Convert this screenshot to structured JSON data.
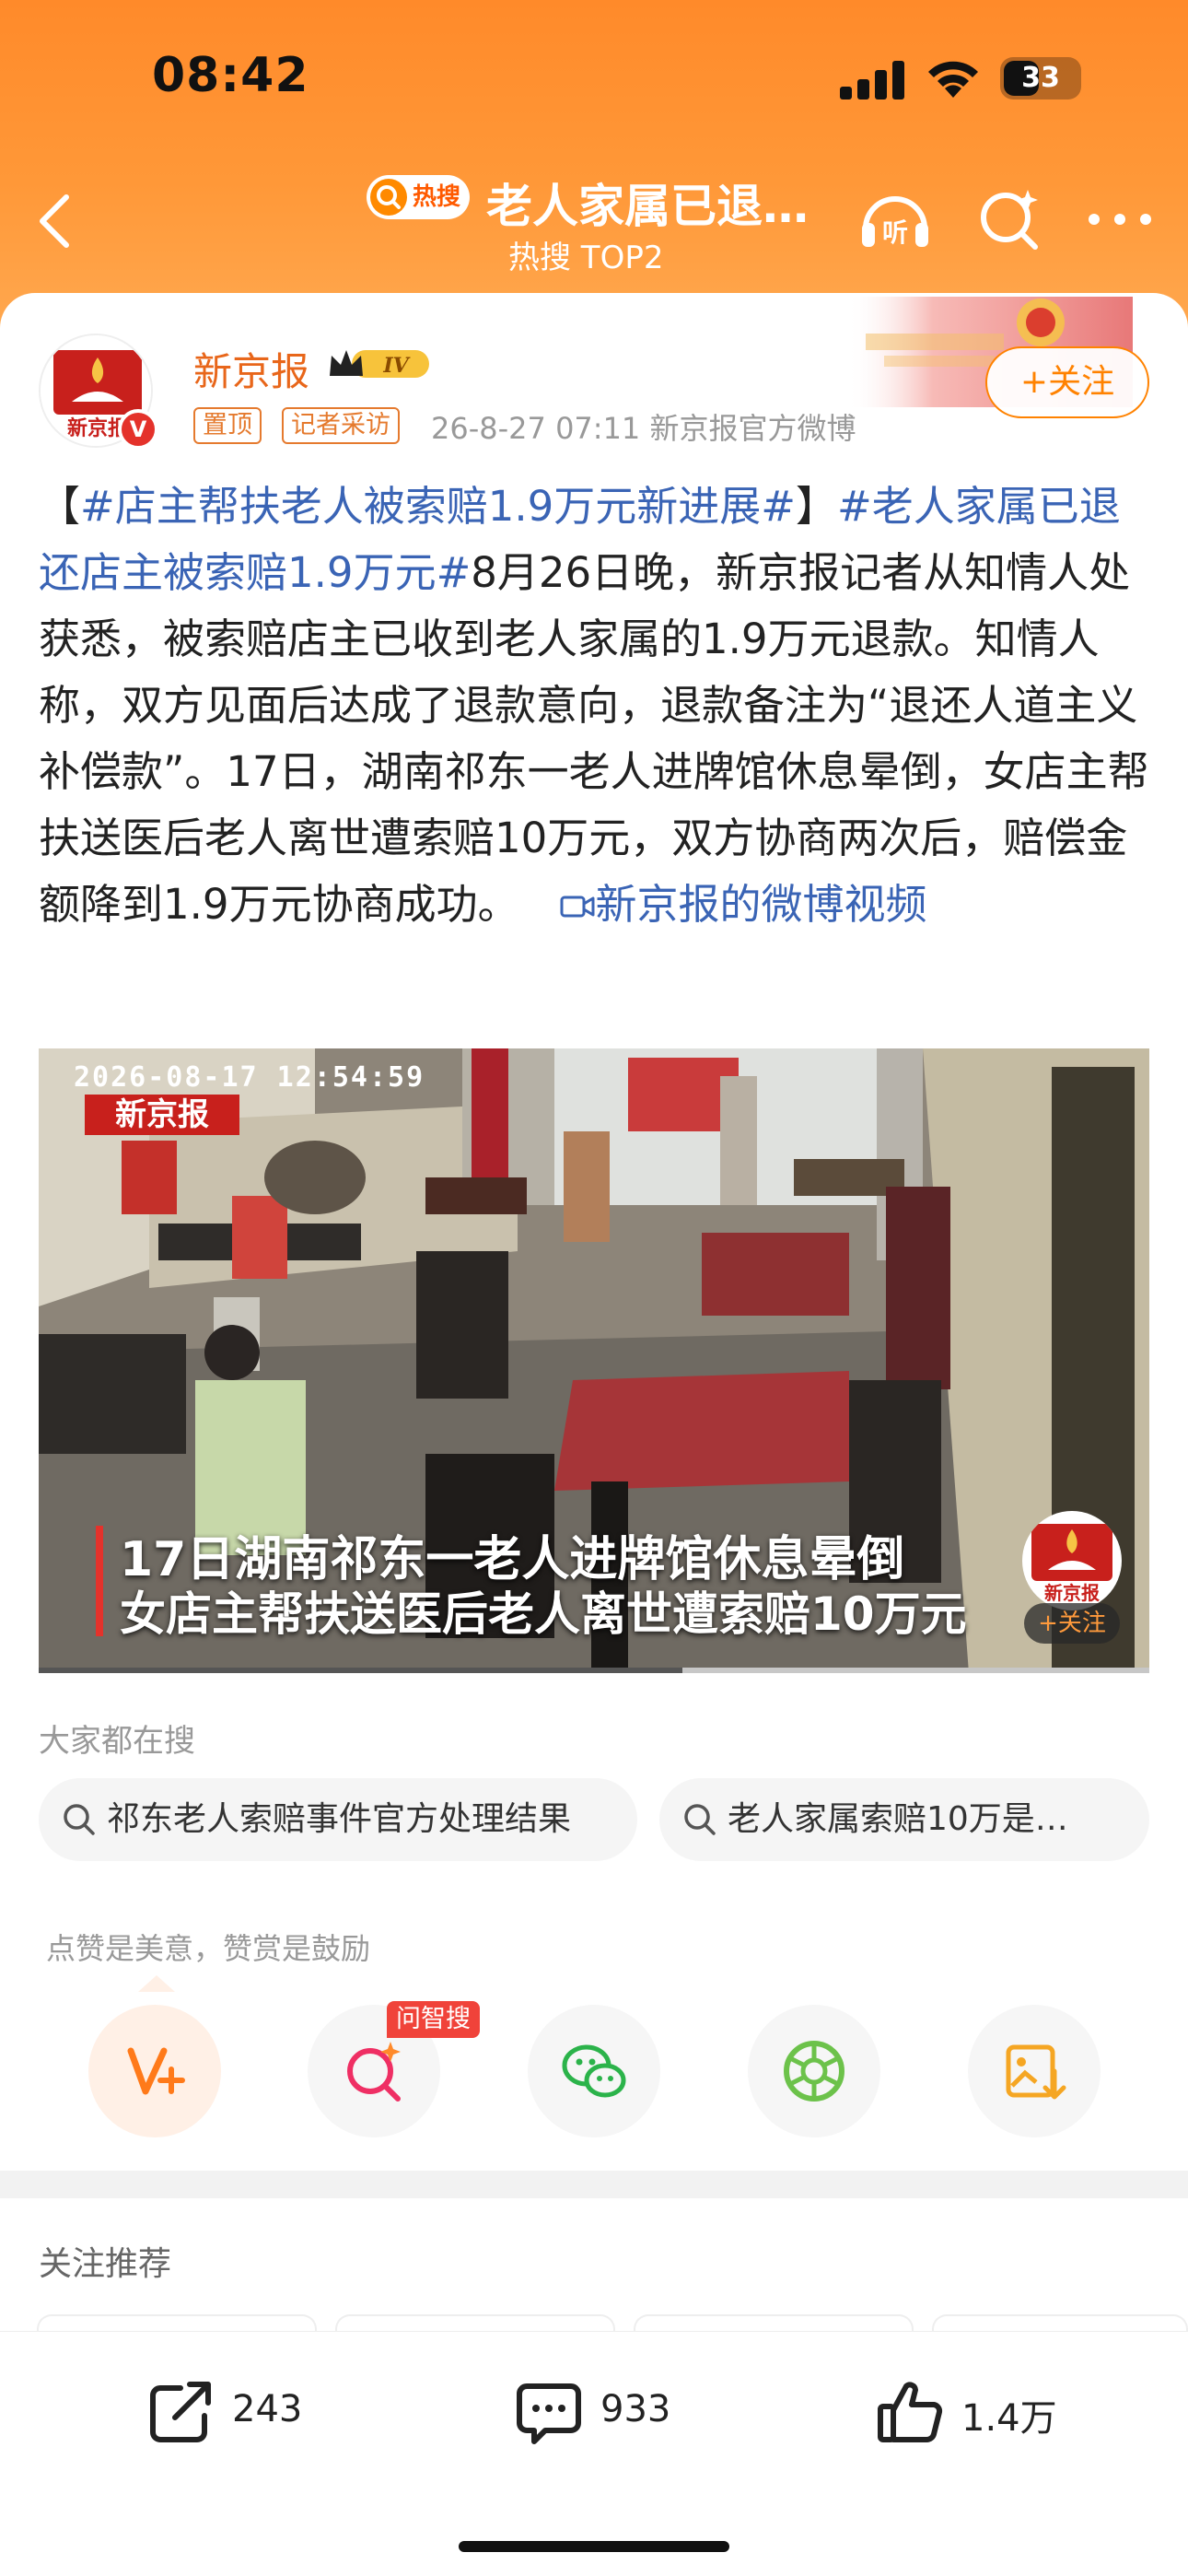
{
  "status_bar": {
    "time": "08:42",
    "battery": "33"
  },
  "header": {
    "hot_badge": "热搜",
    "title": "老人家属已退…",
    "subtitle": "热搜 TOP2"
  },
  "post": {
    "author": "新京报",
    "level": "IV",
    "tag_pinned": "置顶",
    "tag_reporter": "记者采访",
    "meta": "26-8-27 07:11  新京报官方微博",
    "follow_label": "+关注",
    "text": {
      "bracket_open": "【",
      "topic1": "#店主帮扶老人被索赔1.9万元新进展#",
      "bracket_close": "】",
      "topic2": "#老人家属已退还店主被索赔1.9万元#",
      "body": "8月26日晚，新京报记者从知情人处获悉，被索赔店主已收到老人家属的1.9万元退款。知情人称，双方见面后达成了退款意向，退款备注为“退还人道主义补偿款”。17日，湖南祁东一老人进牌馆休息晕倒，女店主帮扶送医后老人离世遭索赔10万元，双方协商两次后，赔偿金额降到1.9万元协商成功。",
      "video_link": "新京报的微博视频"
    }
  },
  "video": {
    "timestamp": "2026-08-17  12:54:59",
    "logo": "新京报",
    "caption_line1": "17日湖南祁东一老人进牌馆休息晕倒",
    "caption_line2": "女店主帮扶送医后老人离世遭索赔10万元",
    "follow_label": "+关注",
    "progress": 0.58
  },
  "searches": {
    "label": "大家都在搜",
    "items": [
      "祁东老人索赔事件官方处理结果",
      "老人家属索赔10万是…"
    ]
  },
  "actions": {
    "label": "点赞是美意，赞赏是鼓励",
    "ask_badge": "问智搜",
    "items": [
      "v-plus-icon",
      "ai-search-icon",
      "wechat-icon",
      "moments-icon",
      "save-image-icon"
    ]
  },
  "recommend": {
    "label": "关注推荐"
  },
  "bottom_bar": {
    "shares": "243",
    "comments": "933",
    "likes": "1.4万"
  },
  "colors": {
    "brand_orange": "#ff8a2a",
    "link_blue": "#3a64b5",
    "accent": "#ff8200"
  }
}
